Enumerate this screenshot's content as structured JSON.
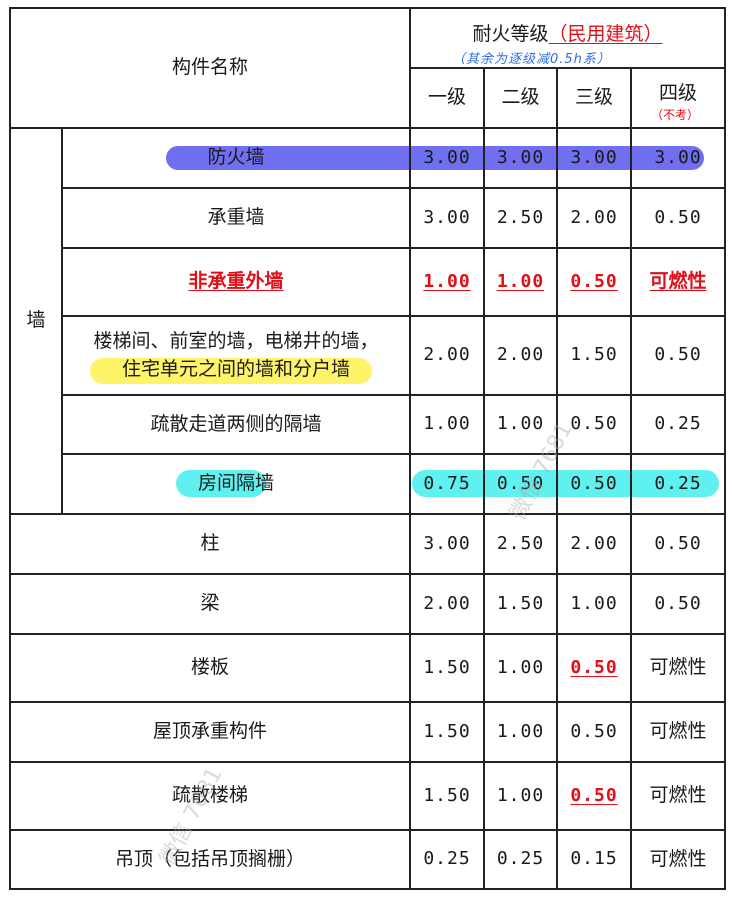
{
  "header": {
    "component_name": "构件名称",
    "fire_rating_prefix": "耐火等级",
    "fire_rating_suffix": "（民用建筑）",
    "handwritten_note": "（其余为逐级减0.5h系）",
    "levels": [
      "一级",
      "二级",
      "三级",
      "四级"
    ],
    "level4_note": "（不考）"
  },
  "wall_group_label": "墙",
  "rows": [
    {
      "name": "防火墙",
      "values": [
        "3.00",
        "3.00",
        "3.00",
        "3.00"
      ]
    },
    {
      "name": "承重墙",
      "values": [
        "3.00",
        "2.50",
        "2.00",
        "0.50"
      ]
    },
    {
      "name": "非承重外墙",
      "values": [
        "1.00",
        "1.00",
        "0.50",
        "可燃性"
      ]
    },
    {
      "name_line1": "楼梯间、前室的墙，电梯井的墙，",
      "name_line2": "住宅单元之间的墙和分户墙",
      "values": [
        "2.00",
        "2.00",
        "1.50",
        "0.50"
      ]
    },
    {
      "name": "疏散走道两侧的隔墙",
      "values": [
        "1.00",
        "1.00",
        "0.50",
        "0.25"
      ]
    },
    {
      "name": "房间隔墙",
      "values": [
        "0.75",
        "0.50",
        "0.50",
        "0.25"
      ]
    },
    {
      "name": "柱",
      "values": [
        "3.00",
        "2.50",
        "2.00",
        "0.50"
      ]
    },
    {
      "name": "梁",
      "values": [
        "2.00",
        "1.50",
        "1.00",
        "0.50"
      ]
    },
    {
      "name": "楼板",
      "values": [
        "1.50",
        "1.00",
        "0.50",
        "可燃性"
      ]
    },
    {
      "name": "屋顶承重构件",
      "values": [
        "1.50",
        "1.00",
        "0.50",
        "可燃性"
      ]
    },
    {
      "name": "疏散楼梯",
      "values": [
        "1.50",
        "1.00",
        "0.50",
        "可燃性"
      ]
    },
    {
      "name": "吊顶（包括吊顶搁栅）",
      "values": [
        "0.25",
        "0.25",
        "0.15",
        "可燃性"
      ]
    }
  ],
  "watermark": "微信 7681",
  "colors": {
    "red": "#e0101a",
    "blue_highlight": "#6f6ff0",
    "cyan_highlight": "#5ff0f0",
    "yellow_highlight": "#fff36a",
    "handwriting_blue": "#2f6de0"
  }
}
